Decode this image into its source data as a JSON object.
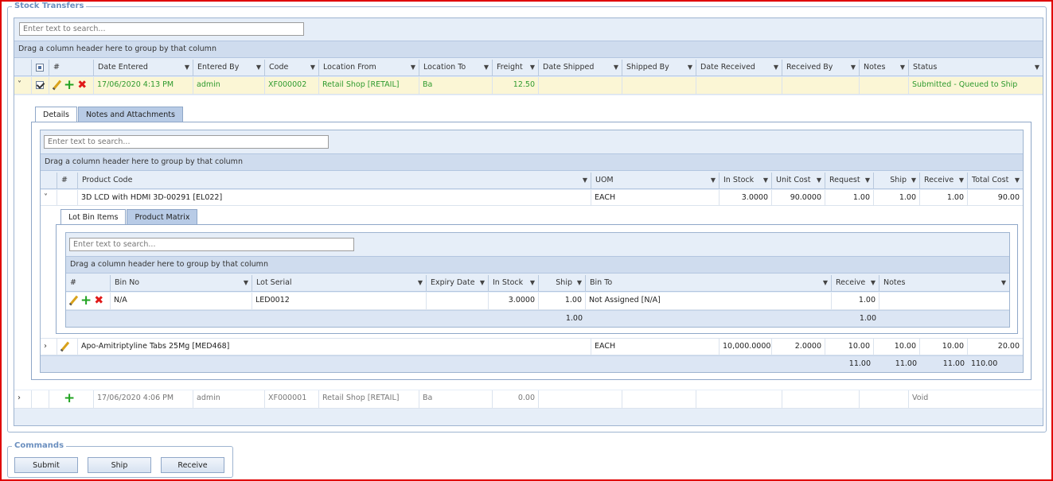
{
  "title": "Stock Transfers",
  "search_placeholder": "Enter text to search...",
  "group_hint": "Drag a column header here to group by that column",
  "columns": {
    "hash": "#",
    "date_entered": "Date Entered",
    "entered_by": "Entered By",
    "code": "Code",
    "location_from": "Location From",
    "location_to": "Location To",
    "freight": "Freight",
    "date_shipped": "Date Shipped",
    "shipped_by": "Shipped By",
    "date_received": "Date Received",
    "received_by": "Received By",
    "notes": "Notes",
    "status": "Status"
  },
  "rows": [
    {
      "date_entered": "17/06/2020 4:13 PM",
      "entered_by": "admin",
      "code": "XF000002",
      "location_from": "Retail Shop [RETAIL]",
      "location_to": "Ba",
      "freight": "12.50",
      "status": "Submitted - Queued to Ship"
    },
    {
      "date_entered": "17/06/2020 4:06 PM",
      "entered_by": "admin",
      "code": "XF000001",
      "location_from": "Retail Shop [RETAIL]",
      "location_to": "Ba",
      "freight": "0.00",
      "status": "Void"
    }
  ],
  "detail_tabs": [
    "Details",
    "Notes and Attachments"
  ],
  "product_columns": {
    "hash": "#",
    "product_code": "Product Code",
    "uom": "UOM",
    "in_stock": "In Stock",
    "unit_cost": "Unit Cost",
    "request": "Request",
    "ship": "Ship",
    "receive": "Receive",
    "total_cost": "Total Cost"
  },
  "products": [
    {
      "product_code": "3D LCD with HDMI 3D-00291 [EL022]",
      "uom": "EACH",
      "in_stock": "3.0000",
      "unit_cost": "90.0000",
      "request": "1.00",
      "ship": "1.00",
      "receive": "1.00",
      "total_cost": "90.00"
    },
    {
      "product_code": "Apo-Amitriptyline Tabs 25Mg [MED468]",
      "uom": "EACH",
      "in_stock": "10,000.0000",
      "unit_cost": "2.0000",
      "request": "10.00",
      "ship": "10.00",
      "receive": "10.00",
      "total_cost": "20.00"
    }
  ],
  "product_totals": {
    "request": "11.00",
    "ship": "11.00",
    "receive": "11.00",
    "total_cost": "110.00"
  },
  "lot_tabs": [
    "Lot Bin Items",
    "Product Matrix"
  ],
  "lot_columns": {
    "hash": "#",
    "bin_no": "Bin No",
    "lot_serial": "Lot Serial",
    "expiry_date": "Expiry Date",
    "in_stock": "In Stock",
    "ship": "Ship",
    "bin_to": "Bin To",
    "receive": "Receive",
    "notes": "Notes"
  },
  "lot_rows": [
    {
      "bin_no": "N/A",
      "lot_serial": "LED0012",
      "expiry_date": "",
      "in_stock": "3.0000",
      "ship": "1.00",
      "bin_to": "Not Assigned [N/A]",
      "receive": "1.00",
      "notes": ""
    }
  ],
  "lot_totals": {
    "ship": "1.00",
    "receive": "1.00"
  },
  "commands": {
    "legend": "Commands",
    "submit": "Submit",
    "ship": "Ship",
    "receive": "Receive"
  },
  "icons": {
    "expand": "chevron-right-icon",
    "collapse": "chevron-down-icon",
    "edit": "pencil-icon",
    "add": "plus-icon",
    "delete": "cross-icon",
    "filter": "filter-icon"
  }
}
